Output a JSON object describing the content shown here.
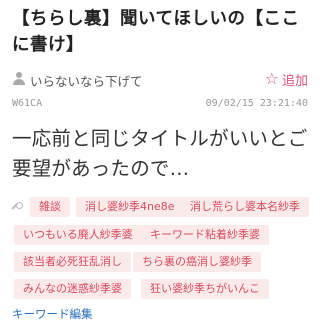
{
  "thread": {
    "title": "【ちらし裏】聞いてほしいの【ここに書け】",
    "author": "いらないなら下げて",
    "favorite_label": "追加",
    "id": "W61CA",
    "timestamp": "09/02/15 23:21:40",
    "body": "一応前と同じタイトルがいいとご要望があったので…"
  },
  "tags": [
    "雑談",
    "消し婆紗季4ne8e",
    "消し荒らし婆本名紗季",
    "いつもいる廃人紗季婆",
    "キーワード粘着紗季婆",
    "該当者必死狂乱消し",
    "ちら裏の癌消し婆紗季",
    "みんなの迷惑紗季婆",
    "狂い婆紗季ちがいんこ"
  ],
  "edit_link": "キーワード編集",
  "colors": {
    "accent": "#d9537a",
    "chip_bg": "#fbeaea",
    "chip_text": "#d94c5e",
    "link": "#2a6ebb"
  }
}
